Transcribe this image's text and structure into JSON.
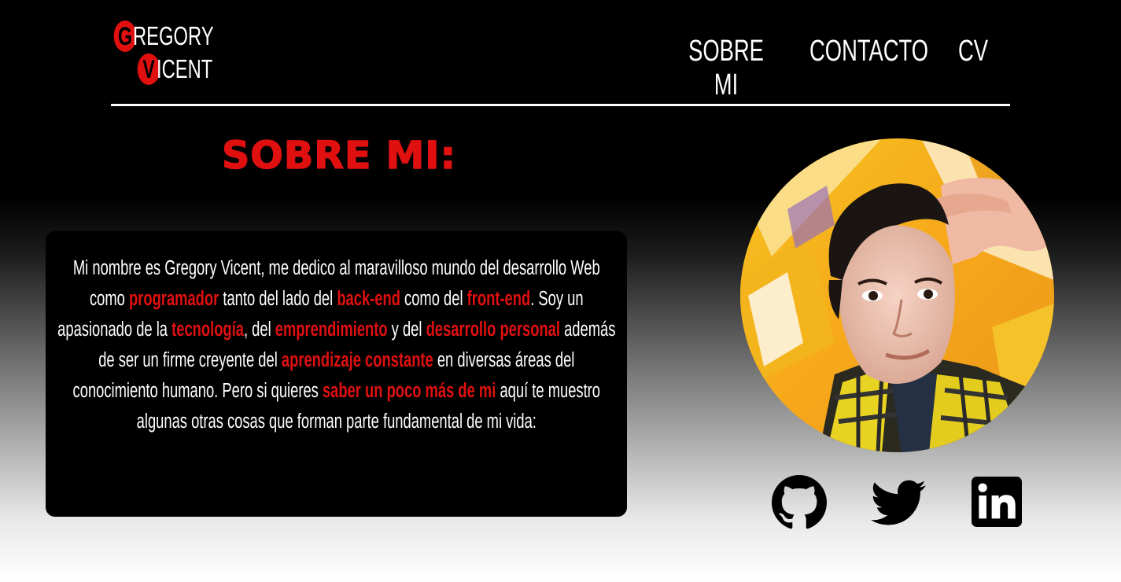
{
  "logo": {
    "line1_initial": "G",
    "line1_rest": "REGORY",
    "line2_initial": "V",
    "line2_rest": "ICENT"
  },
  "nav": {
    "items": [
      "SOBRE MI",
      "CONTACTO",
      "CV"
    ]
  },
  "section": {
    "title": "SOBRE MI:"
  },
  "bio": {
    "t1": "Mi nombre es Gregory Vicent, me dedico al maravilloso mundo del desarrollo Web como ",
    "h1": "programador",
    "t2": " tanto del lado del ",
    "h2": "back-end",
    "t3": " como del ",
    "h3": "front-end",
    "t4": ". Soy un apasionado de la ",
    "h4": "tecnología",
    "t5": ", del ",
    "h5": "emprendimiento",
    "t6": " y del ",
    "h6": "desarrollo personal",
    "t7": " además de ser un firme creyente del ",
    "h7": "aprendizaje constante",
    "t8": " en diversas áreas del conocimiento humano. Pero si quieres ",
    "h8": "saber un poco más de mi",
    "t9": " aquí te muestro algunas otras cosas que forman parte fundamental de mi vida:"
  },
  "socials": {
    "items": [
      {
        "icon": "github-icon"
      },
      {
        "icon": "twitter-icon"
      },
      {
        "icon": "linkedin-icon"
      }
    ]
  },
  "colors": {
    "accent": "#e01010",
    "background_top": "#000000",
    "background_bottom": "#ffffff",
    "text": "#ffffff"
  }
}
